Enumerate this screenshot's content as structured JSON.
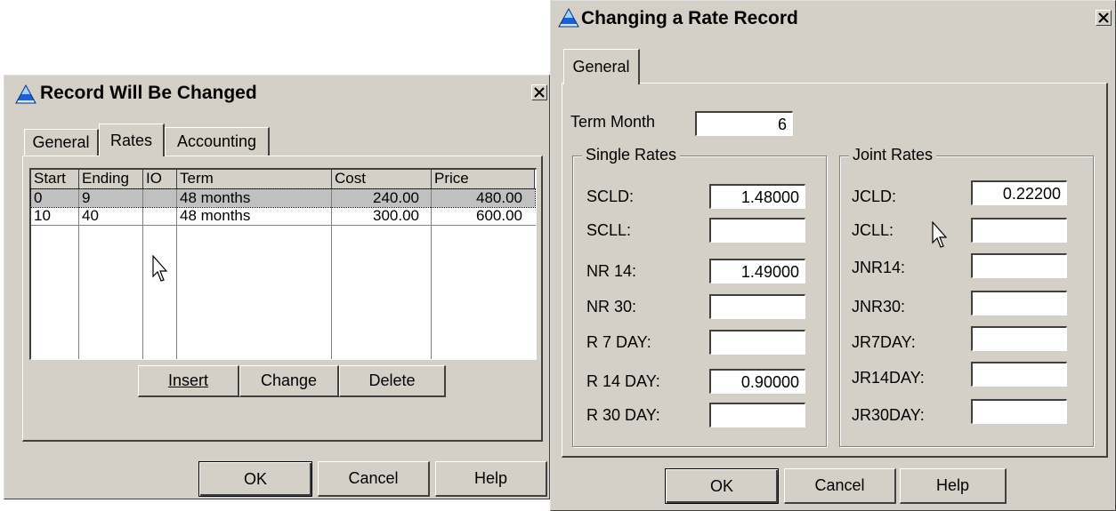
{
  "dialog1": {
    "title": "Record Will Be Changed",
    "tabs": [
      "General",
      "Rates",
      "Accounting"
    ],
    "active_tab": "Rates",
    "grid": {
      "columns": [
        "Start",
        "Ending",
        "IO",
        "Term",
        "Cost",
        "Price"
      ],
      "rows": [
        {
          "start": "0",
          "ending": "9",
          "io": "",
          "term": "48 months",
          "cost": "240.00",
          "price": "480.00",
          "selected": true
        },
        {
          "start": "10",
          "ending": "40",
          "io": "",
          "term": "48 months",
          "cost": "300.00",
          "price": "600.00",
          "selected": false
        }
      ]
    },
    "buttons": {
      "insert": "Insert",
      "change": "Change",
      "delete": "Delete"
    },
    "footer": {
      "ok": "OK",
      "cancel": "Cancel",
      "help": "Help"
    }
  },
  "dialog2": {
    "title": "Changing a Rate Record",
    "tab": "General",
    "term_month_label": "Term Month",
    "term_month_value": "6",
    "single_rates": {
      "title": "Single Rates",
      "fields": [
        {
          "label": "SCLD:",
          "value": "1.48000"
        },
        {
          "label": "SCLL:",
          "value": ""
        },
        {
          "label": "NR 14:",
          "value": "1.49000"
        },
        {
          "label": "NR 30:",
          "value": ""
        },
        {
          "label": "R 7 DAY:",
          "value": ""
        },
        {
          "label": "R 14 DAY:",
          "value": "0.90000"
        },
        {
          "label": "R 30 DAY:",
          "value": ""
        }
      ]
    },
    "joint_rates": {
      "title": "Joint Rates",
      "fields": [
        {
          "label": "JCLD:",
          "value": "0.22200"
        },
        {
          "label": "JCLL:",
          "value": ""
        },
        {
          "label": "JNR14:",
          "value": ""
        },
        {
          "label": "JNR30:",
          "value": ""
        },
        {
          "label": "JR7DAY:",
          "value": ""
        },
        {
          "label": "JR14DAY:",
          "value": ""
        },
        {
          "label": "JR30DAY:",
          "value": ""
        }
      ]
    },
    "footer": {
      "ok": "OK",
      "cancel": "Cancel",
      "help": "Help"
    }
  },
  "icons": {
    "app": "triangle-app-icon",
    "close": "close-icon",
    "pointer": "mouse-pointer-icon"
  },
  "colors": {
    "dialog_bg": "#d4d0c8",
    "icon_blue": "#1c5fd6",
    "selection": "#c0c0c0"
  }
}
